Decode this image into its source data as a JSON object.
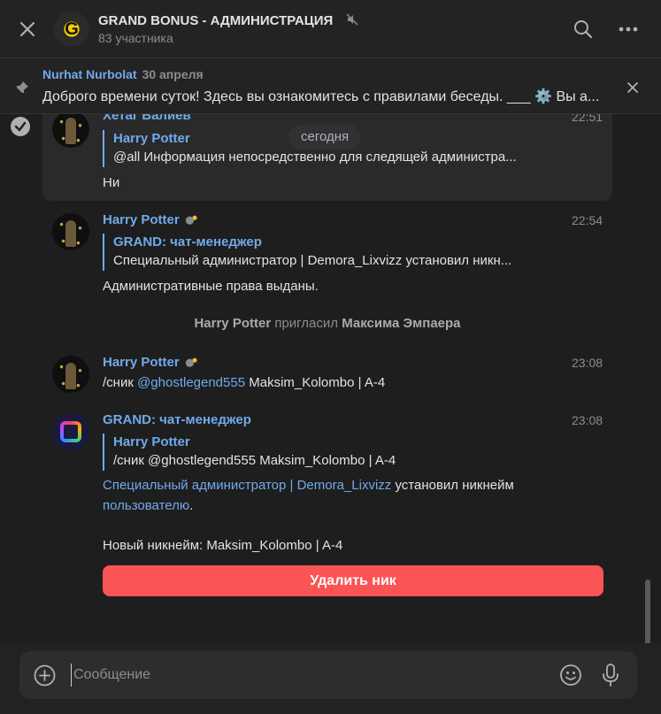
{
  "header": {
    "title": "GRAND BONUS - АДМИНИСТРАЦИЯ",
    "subtitle": "83 участника",
    "avatar_letter": "G"
  },
  "pinned": {
    "author": "Nurhat Nurbolat",
    "date": "30 апреля",
    "text": "Доброго времени суток! Здесь вы ознакомитесь с правилами беседы. ___ ⚙️ Вы а..."
  },
  "chat": {
    "date_separator": "сегодня",
    "messages": [
      {
        "author": "Хетаг Валиев",
        "time": "22:51",
        "quote_author": "Harry Potter",
        "quote_text": "@all Информация непосредственно для следящей администра...",
        "text": "Ни"
      },
      {
        "author": "Harry Potter",
        "time": "22:54",
        "quote_author": "GRAND: чат-менеджер",
        "quote_text": "Специальный администратор | Demora_Lixvizz установил никн...",
        "text": "Административные права выданы."
      },
      {
        "author": "Harry Potter",
        "time": "23:08",
        "text_prefix": "/сник ",
        "mention": "@ghostlegend555",
        "text_suffix": " Maksim_Kolombo | A-4"
      },
      {
        "author": "GRAND: чат-менеджер",
        "time": "23:08",
        "quote_author": "Harry Potter",
        "quote_text": "/сник @ghostlegend555 Maksim_Kolombo | A-4",
        "link1": "Специальный администратор | Demora_Lixvizz",
        "text_mid": " установил никнейм",
        "link2": "пользователю",
        "text_end": ".",
        "new_nick": "Новый никнейм: Maksim_Kolombo | A-4",
        "button_label": "Удалить ник"
      }
    ],
    "service": {
      "actor": "Harry Potter",
      "action": " пригласил ",
      "target": "Максима Эмпаера"
    }
  },
  "composer": {
    "placeholder": "Сообщение"
  }
}
